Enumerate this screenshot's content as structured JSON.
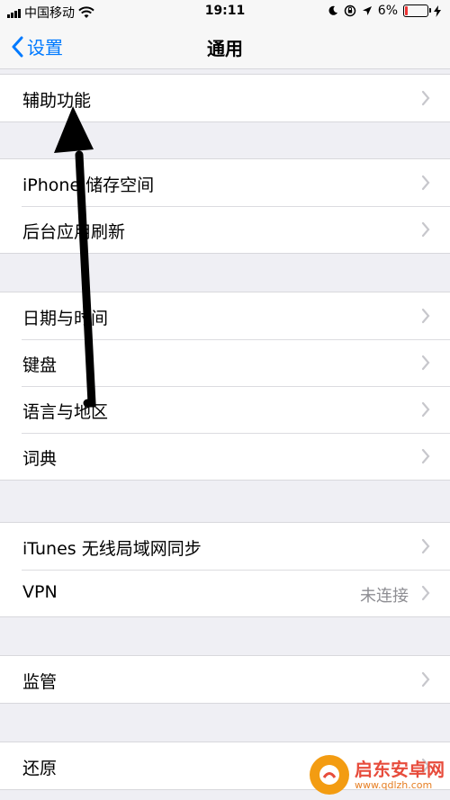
{
  "status_bar": {
    "carrier": "中国移动",
    "time": "19:11",
    "battery_percent": "6%",
    "battery_color": "#e33333"
  },
  "nav": {
    "back_label": "设置",
    "title": "通用",
    "accent_color": "#007aff"
  },
  "groups": [
    {
      "items": [
        {
          "label": "辅助功能"
        }
      ]
    },
    {
      "items": [
        {
          "label": "iPhone 储存空间"
        },
        {
          "label": "后台应用刷新"
        }
      ]
    },
    {
      "items": [
        {
          "label": "日期与时间"
        },
        {
          "label": "键盘"
        },
        {
          "label": "语言与地区"
        },
        {
          "label": "词典"
        }
      ]
    },
    {
      "items": [
        {
          "label": "iTunes 无线局域网同步"
        },
        {
          "label": "VPN",
          "value": "未连接"
        }
      ]
    },
    {
      "items": [
        {
          "label": "监管"
        }
      ]
    },
    {
      "items": [
        {
          "label": "还原"
        }
      ]
    }
  ],
  "watermark": {
    "name": "启东安卓网",
    "url": "www.qdlzh.com"
  }
}
